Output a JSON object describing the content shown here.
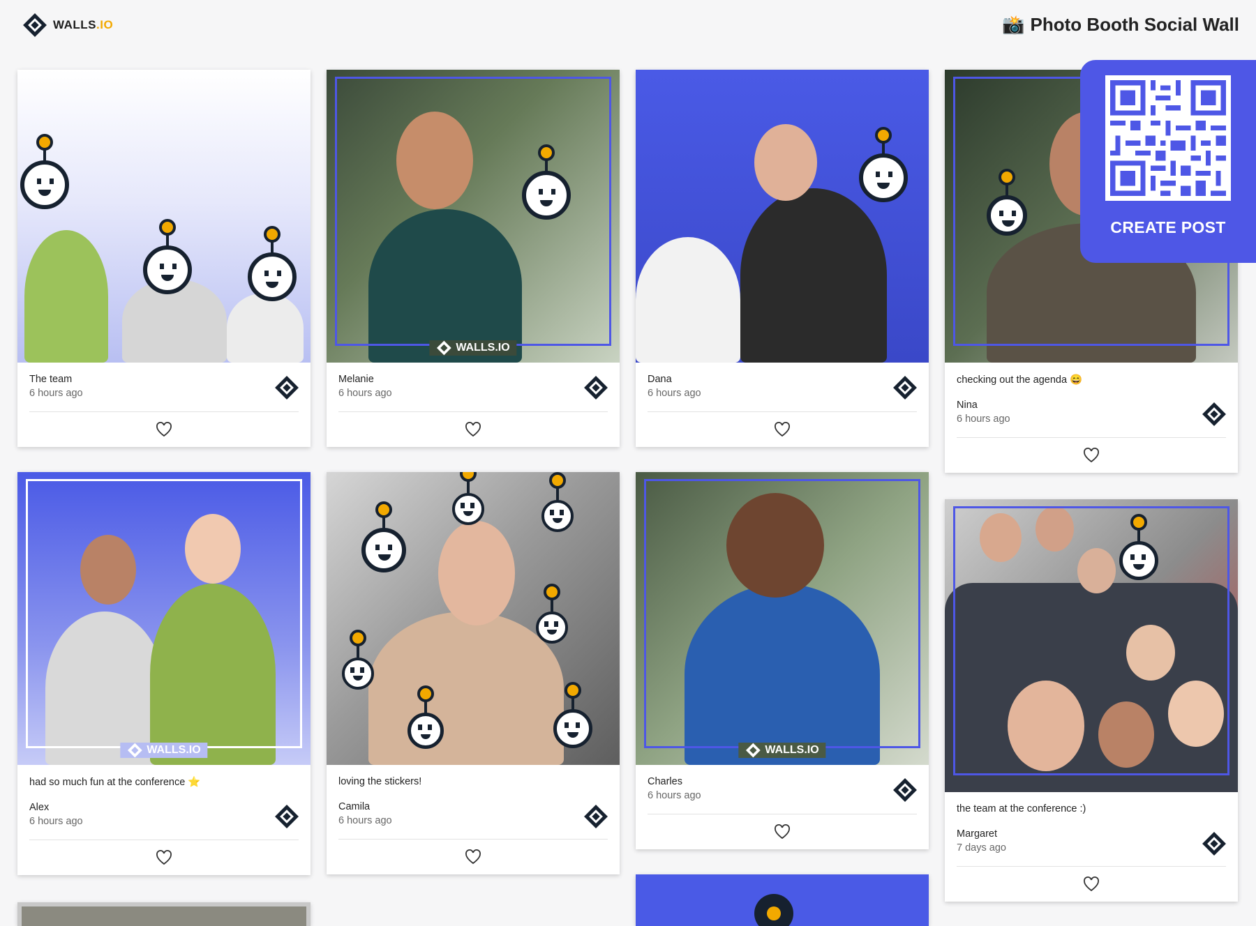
{
  "header": {
    "logo_text": "WALLS",
    "logo_tld": ".IO",
    "title_icon": "📸",
    "title": "Photo Booth Social Wall"
  },
  "create_post": {
    "label": "CREATE POST",
    "qr_icon": "qr-code-icon"
  },
  "brand_watermark": "WALLS.IO",
  "posts": [
    {
      "author": "The team",
      "time": "6 hours ago",
      "caption": ""
    },
    {
      "author": "Melanie",
      "time": "6 hours ago",
      "caption": ""
    },
    {
      "author": "Dana",
      "time": "6 hours ago",
      "caption": ""
    },
    {
      "author": "Nina",
      "time": "6 hours ago",
      "caption": "checking out the agenda 😄"
    },
    {
      "author": "Alex",
      "time": "6 hours ago",
      "caption": "had so much fun at the conference ⭐"
    },
    {
      "author": "Camila",
      "time": "6 hours ago",
      "caption": "loving the stickers!"
    },
    {
      "author": "Charles",
      "time": "6 hours ago",
      "caption": ""
    },
    {
      "author": "Margaret",
      "time": "7 days ago",
      "caption": "the team at the conference :)"
    }
  ],
  "colors": {
    "accent": "#4e57e6",
    "brand_yellow": "#f2a900",
    "background": "#f6f6f7"
  }
}
